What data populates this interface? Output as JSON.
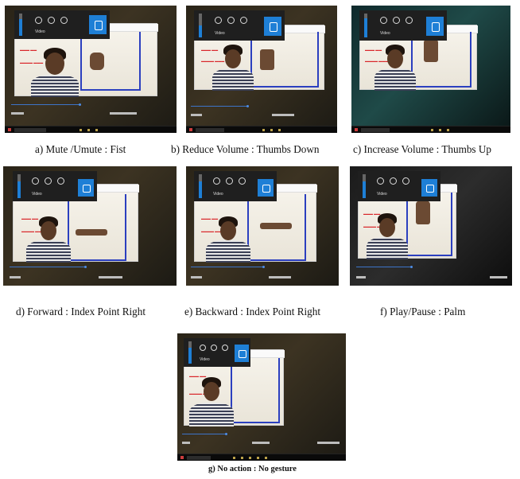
{
  "figure": {
    "panels": [
      {
        "id": "a",
        "caption": "a) Mute /Umute : Fist",
        "player_label": "Video",
        "volume_level": 0.75
      },
      {
        "id": "b",
        "caption": "b) Reduce Volume : Thumbs Down",
        "player_label": "Video",
        "volume_level": 0.5
      },
      {
        "id": "c",
        "caption": "c) Increase Volume : Thumbs Up",
        "player_label": "Video",
        "volume_level": 0.8
      },
      {
        "id": "d",
        "caption": "d) Forward : Index Point Right",
        "player_label": "Video",
        "volume_level": 0.7
      },
      {
        "id": "e",
        "caption": "e) Backward : Index Point Right",
        "player_label": "Video",
        "volume_level": 0.7
      },
      {
        "id": "f",
        "caption": "f) Play/Pause : Palm",
        "player_label": "Video",
        "volume_level": 0.7
      },
      {
        "id": "g",
        "caption": "g) No action : No gesture",
        "player_label": "Video",
        "volume_level": 0.7
      }
    ],
    "colors": {
      "accent": "#1e7fd6",
      "overlay_text": "#d9262a",
      "bounding_box": "#2b3fbf"
    },
    "icons": [
      "speaker-icon",
      "previous-icon",
      "play-pause-icon",
      "next-icon",
      "windows-start-icon"
    ]
  }
}
